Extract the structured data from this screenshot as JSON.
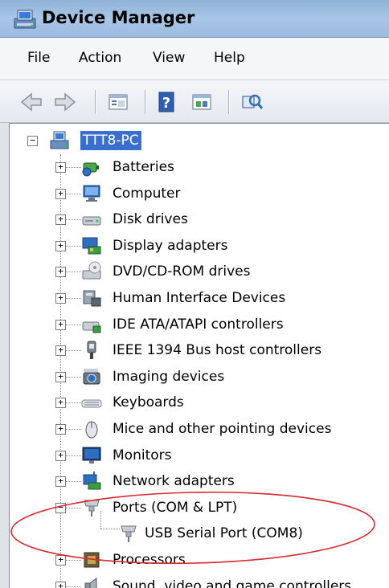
{
  "window": {
    "title": "Device Manager"
  },
  "menu": {
    "items": [
      "File",
      "Action",
      "View",
      "Help"
    ]
  },
  "toolbar": {
    "buttons": [
      "back-icon",
      "forward-icon",
      "properties-icon",
      "help-icon",
      "update-driver-icon",
      "scan-hardware-icon"
    ]
  },
  "tree": {
    "root": {
      "label": "TTT8-PC",
      "expander": "−",
      "icon": "computer-icon"
    },
    "nodes": [
      {
        "label": "Batteries",
        "expander": "+",
        "icon": "battery-icon"
      },
      {
        "label": "Computer",
        "expander": "+",
        "icon": "computer-monitor-icon"
      },
      {
        "label": "Disk drives",
        "expander": "+",
        "icon": "disk-drive-icon"
      },
      {
        "label": "Display adapters",
        "expander": "+",
        "icon": "display-adapter-icon"
      },
      {
        "label": "DVD/CD-ROM drives",
        "expander": "+",
        "icon": "dvd-drive-icon"
      },
      {
        "label": "Human Interface Devices",
        "expander": "+",
        "icon": "hid-icon"
      },
      {
        "label": "IDE ATA/ATAPI controllers",
        "expander": "+",
        "icon": "ide-controller-icon"
      },
      {
        "label": "IEEE 1394 Bus host controllers",
        "expander": "+",
        "icon": "firewire-icon"
      },
      {
        "label": "Imaging devices",
        "expander": "+",
        "icon": "camera-icon"
      },
      {
        "label": "Keyboards",
        "expander": "+",
        "icon": "keyboard-icon"
      },
      {
        "label": "Mice and other pointing devices",
        "expander": "+",
        "icon": "mouse-icon"
      },
      {
        "label": "Monitors",
        "expander": "+",
        "icon": "monitor-icon"
      },
      {
        "label": "Network adapters",
        "expander": "+",
        "icon": "network-adapter-icon"
      },
      {
        "label": "Ports (COM & LPT)",
        "expander": "−",
        "icon": "port-icon"
      },
      {
        "label": "USB Serial Port (COM8)",
        "child": true,
        "icon": "port-icon"
      },
      {
        "label": "Processors",
        "expander": "+",
        "icon": "processor-icon"
      },
      {
        "label": "Sound, video and game controllers",
        "expander": "+",
        "icon": "speaker-icon"
      }
    ]
  },
  "annotation": {
    "shape": "ellipse",
    "color": "#d9282f"
  }
}
